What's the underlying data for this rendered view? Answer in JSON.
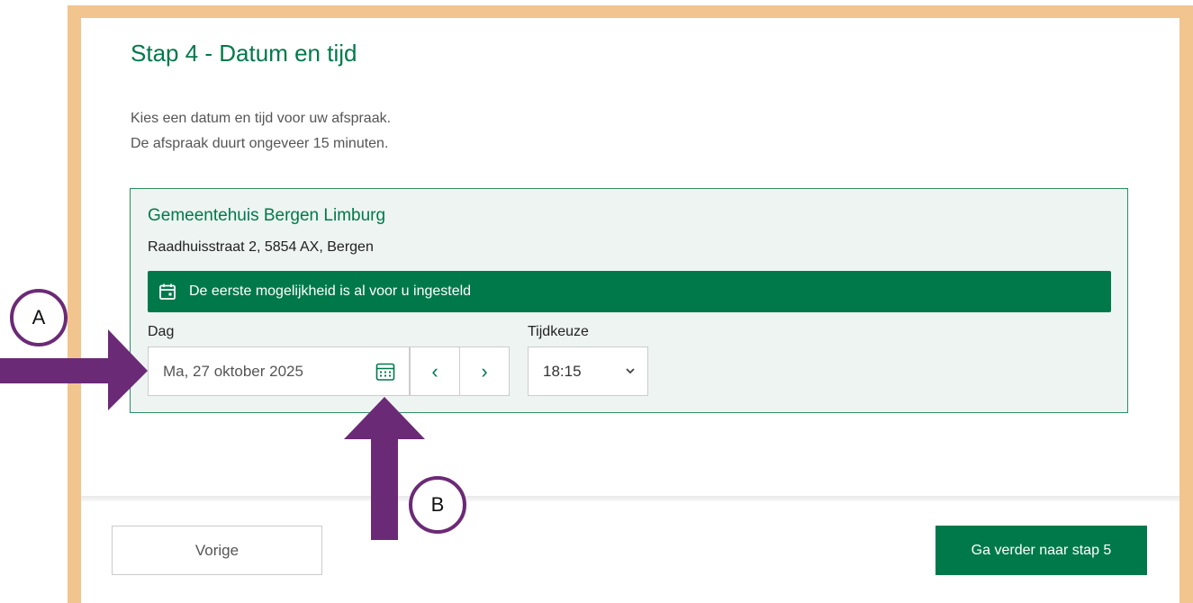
{
  "step": {
    "title": "Stap 4 - Datum en tijd",
    "intro_line1": "Kies een datum en tijd voor uw afspraak.",
    "intro_line2": "De afspraak duurt ongeveer 15 minuten."
  },
  "location": {
    "name": "Gemeentehuis Bergen Limburg",
    "address": "Raadhuisstraat 2, 5854 AX, Bergen",
    "notice": "De eerste mogelijkheid is al voor u ingesteld"
  },
  "form": {
    "day_label": "Dag",
    "day_value": "Ma, 27 oktober 2025",
    "prev_day_icon": "‹",
    "next_day_icon": "›",
    "time_label": "Tijdkeuze",
    "time_value": "18:15"
  },
  "footer": {
    "prev_label": "Vorige",
    "next_label": "Ga verder naar stap 5"
  },
  "annotations": {
    "marker_a": "A",
    "marker_b": "B"
  },
  "colors": {
    "brand_green": "#00794a",
    "frame_orange": "#f2c48e",
    "arrow_purple": "#6b2a76"
  }
}
